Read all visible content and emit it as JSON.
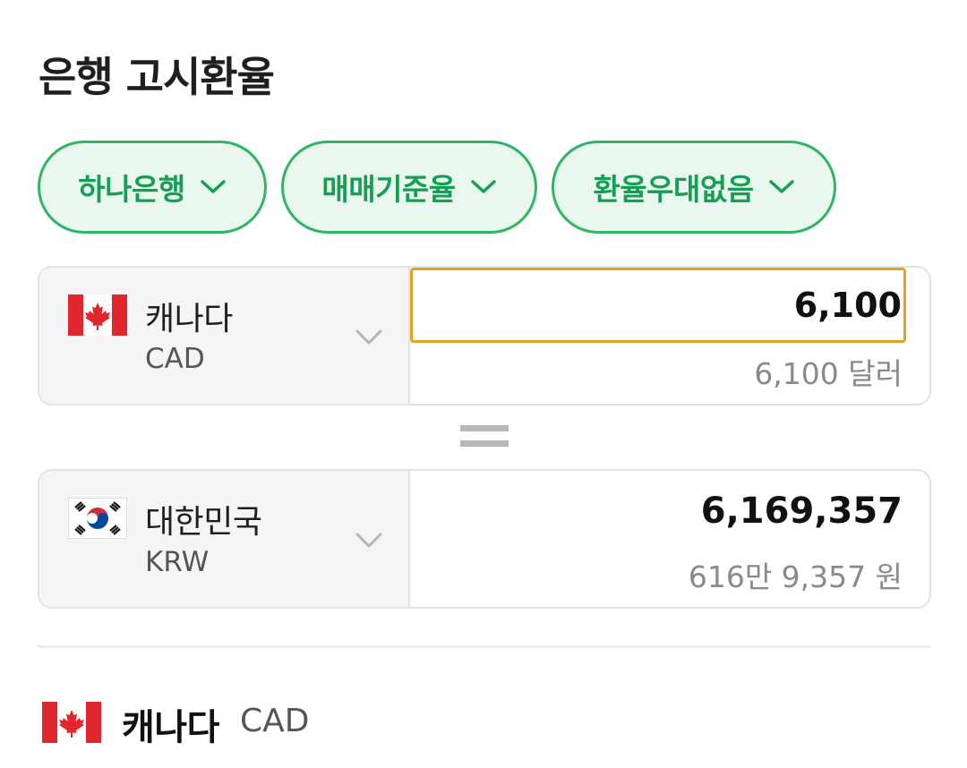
{
  "page_title": "은행 고시환율",
  "filters": [
    {
      "label": "하나은행"
    },
    {
      "label": "매매기준율"
    },
    {
      "label": "환율우대없음"
    }
  ],
  "from_currency": {
    "name": "캐나다",
    "code": "CAD",
    "amount": "6,100",
    "amount_text": "6,100 달러"
  },
  "to_currency": {
    "name": "대한민국",
    "code": "KRW",
    "amount": "6,169,357",
    "amount_text": "616만 9,357 원"
  },
  "detail": {
    "name": "캐나다",
    "code": "CAD"
  },
  "colors": {
    "chip_accent": "#2fb565",
    "chip_text": "#14a052",
    "input_focus": "#e0a324"
  }
}
